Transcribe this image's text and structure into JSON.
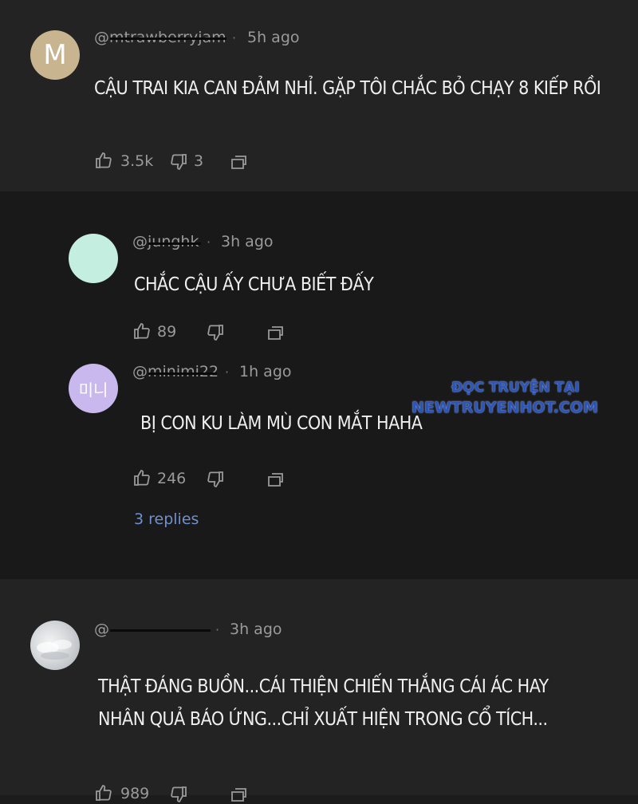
{
  "comments": [
    {
      "avatar_letter": "M",
      "handle": "@mtrawberryjam",
      "time": "5h ago",
      "text": "CẬU TRAI KIA CAN ĐẢM NHỈ. GẶP TÔI CHẮC BỎ CHẠY 8 KIẾP RỒI",
      "likes": "3.5k",
      "dislikes": "3"
    },
    {
      "avatar_letter": "",
      "handle": "@junghk",
      "time": "3h ago",
      "text": "CHẮC CẬU ẤY CHƯA BIẾT ĐẤY",
      "likes": "89"
    },
    {
      "avatar_letter": "미니",
      "handle": "@minimi22",
      "time": "1h ago",
      "text": "BỊ CON KU LÀM MÙ CON MẮT HAHA",
      "likes": "246",
      "replies_link": "3 replies"
    },
    {
      "handle": "@",
      "time": "3h ago",
      "text_line1": "THẬT ĐÁNG BUỒN...CÁI THIỆN CHIẾN THẮNG CÁI ÁC HAY",
      "text_line2": "NHÂN QUẢ BÁO ỨNG...CHỈ XUẤT HIỆN TRONG CỔ TÍCH...",
      "likes": "989"
    }
  ],
  "watermark": {
    "line1": "ĐỌC TRUYỆN TẠI",
    "line2": "NEWTRUYENHOT.COM"
  },
  "colors": {
    "background": "#1c1c1c",
    "avatar_m": "#c8b48e",
    "avatar_mint": "#c3eee0",
    "avatar_lavender": "#c8b8ee",
    "link": "#6f8fd0",
    "watermark": "#2d55b8"
  }
}
